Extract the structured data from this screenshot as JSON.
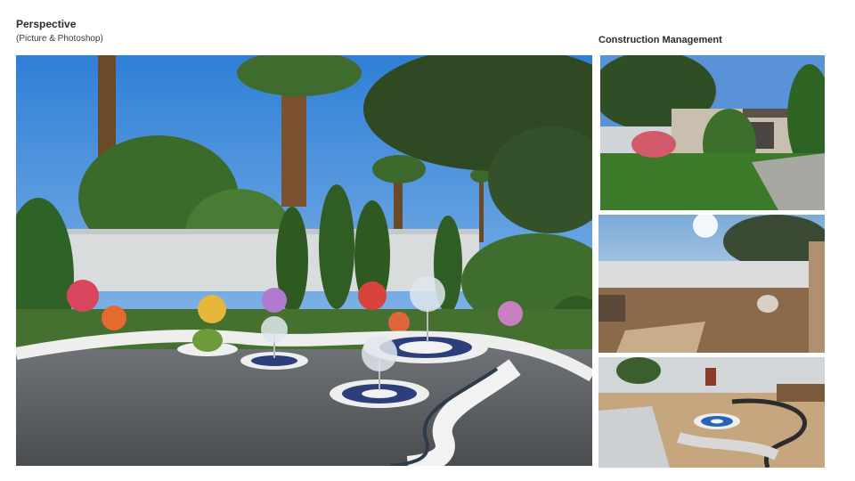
{
  "heading": {
    "title": "Perspective",
    "subtitle": "(Picture & Photoshop)"
  },
  "side_panel": {
    "title": "Construction Management"
  }
}
